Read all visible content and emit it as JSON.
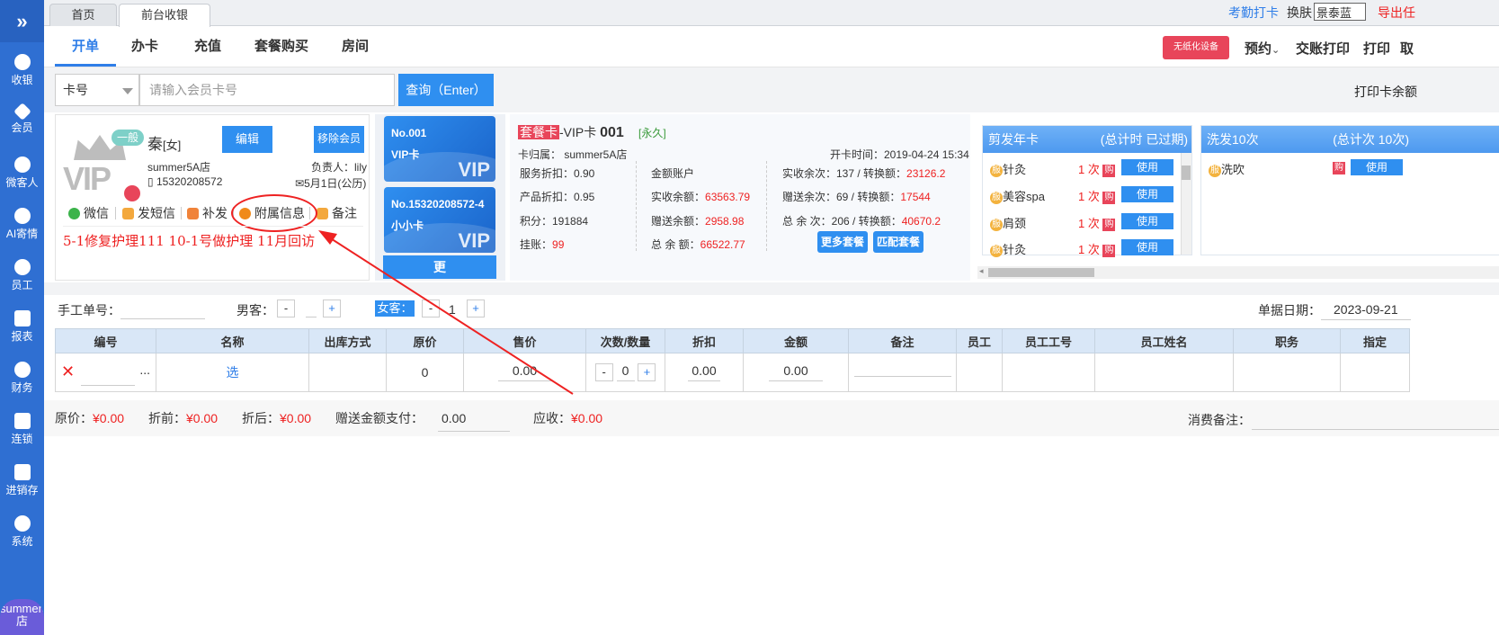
{
  "sidebar": {
    "toggle": "»",
    "items": [
      {
        "label": "收银",
        "icon": "yen-icon"
      },
      {
        "label": "会员",
        "icon": "diamond-icon"
      },
      {
        "label": "微客人",
        "icon": "clover-icon"
      },
      {
        "label": "AI寄情",
        "icon": "user-settings-icon"
      },
      {
        "label": "员工",
        "icon": "person-icon"
      },
      {
        "label": "报表",
        "icon": "monitor-icon"
      },
      {
        "label": "财务",
        "icon": "pie-icon"
      },
      {
        "label": "连锁",
        "icon": "building-icon"
      },
      {
        "label": "进销存",
        "icon": "house-icon"
      },
      {
        "label": "系统",
        "icon": "gear-icon"
      }
    ],
    "avatar": "summer5A店"
  },
  "tabs": [
    {
      "label": "首页"
    },
    {
      "label": "前台收银"
    }
  ],
  "topbar": {
    "attendance": "考勤打卡",
    "skin_label": "换肤",
    "skin_value": "景泰蓝",
    "export": "导出任"
  },
  "nav": {
    "tabs": [
      "开单",
      "办卡",
      "充值",
      "套餐购买",
      "房间"
    ],
    "paperless_badge": "无纸化设备",
    "reserve": "预约",
    "shift_print": "交账打印",
    "print": "打印",
    "cut": "取"
  },
  "search": {
    "card_type": "卡号",
    "placeholder": "请输入会员卡号",
    "query_btn": "查询（Enter）",
    "print_balance": "打印卡余额"
  },
  "member": {
    "level": "一般",
    "vip_text": "VIP",
    "name": "秦",
    "gender": "[女]",
    "edit": "编辑",
    "remove": "移除会员",
    "store": "summer5A店",
    "phone": "15320208572",
    "manager": "负责人：lily",
    "birthday": "5月1日(公历)",
    "actions": [
      "微信",
      "发短信",
      "补发",
      "附属信息",
      "备注"
    ],
    "remark": "5-1修复护理111  10-1号做护理  11月回访"
  },
  "cards": [
    {
      "no": "No.001",
      "type": "VIP卡",
      "vip": "VIP"
    },
    {
      "no": "No.15320208572-4",
      "type": "小小卡",
      "vip": "VIP"
    }
  ],
  "cards_more": "更",
  "card_info": {
    "tag": "套餐卡",
    "card_name": "-VIP卡",
    "card_no": "001",
    "validity": "[永久]",
    "owner": "卡归属：  summer5A店",
    "open_time": "开卡时间：2019-04-24 15:34",
    "service_discount": "服务折扣：0.90",
    "product_discount": "产品折扣：0.95",
    "points": "积分：191884",
    "credit_label": "挂账：",
    "credit": "99",
    "account": "金额账户",
    "real_balance_label": "实收余额：",
    "real_balance": "63563.79",
    "gift_balance_label": "赠送余额：",
    "gift_balance": "2958.98",
    "total_balance_label": "总 余 额：",
    "total_balance": "66522.77",
    "real_times_label": "实收余次：137  / 转换额：",
    "real_times": "23126.2",
    "gift_times_label": "赠送余次：69   / 转换额：",
    "gift_times": "17544",
    "total_times_label": "总 余 次：206 / 转换额：",
    "total_times": "40670.2",
    "more_packages": "更多套餐",
    "match_packages": "匹配套餐"
  },
  "packages": [
    {
      "title": "剪发年卡",
      "status": "(总计时 已过期)",
      "rows": [
        {
          "name": "针灸",
          "count": "1 次",
          "btn": "使用"
        },
        {
          "name": "美容spa",
          "count": "1 次",
          "btn": "使用"
        },
        {
          "name": "肩颈",
          "count": "1 次",
          "btn": "使用"
        },
        {
          "name": "针灸",
          "count": "1 次",
          "btn": "使用"
        }
      ]
    },
    {
      "title": "洗发10次",
      "status": "(总计次 10次)",
      "rows": [
        {
          "name": "洗吹",
          "count": "",
          "btn": "使用"
        }
      ]
    }
  ],
  "order": {
    "manual_no_label": "手工单号：",
    "male_label": "男客：",
    "male_value": "",
    "female_label": "女客：",
    "female_value": "1",
    "date_label": "单据日期：",
    "date": "2023-09-21"
  },
  "table": {
    "headers": [
      "编号",
      "名称",
      "出库方式",
      "原价",
      "售价",
      "次数/数量",
      "折扣",
      "金额",
      "备注",
      "员工",
      "员工工号",
      "员工姓名",
      "职务",
      "指定"
    ],
    "row": {
      "select": "选",
      "orig_price": "0",
      "price": "0.00",
      "qty": "0",
      "discount": "0.00",
      "amount": "0.00",
      "dots": "..."
    }
  },
  "summary": {
    "orig_label": "原价：",
    "orig": "¥0.00",
    "before_label": "折前：",
    "before": "¥0.00",
    "after_label": "折后：",
    "after": "¥0.00",
    "gift_pay_label": "赠送金额支付：",
    "gift_pay": "0.00",
    "receivable_label": "应收：",
    "receivable": "¥0.00",
    "remark_label": "消费备注："
  },
  "colors": {
    "primary": "#2f8ff0",
    "sidebar": "#2f6fd2",
    "danger": "#e22222"
  }
}
